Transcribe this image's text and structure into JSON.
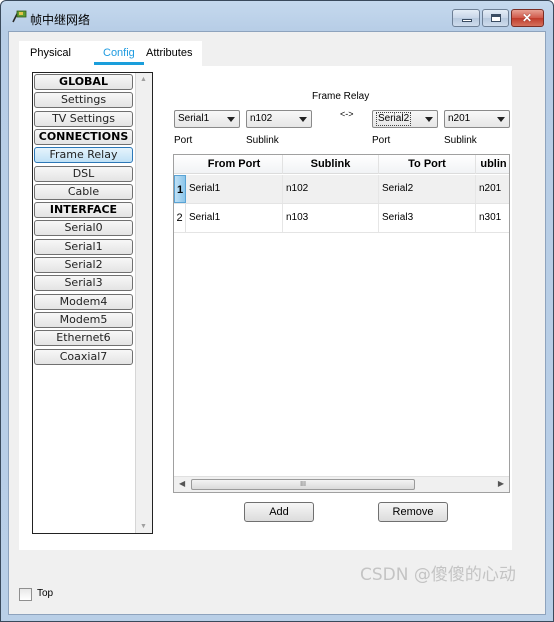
{
  "window": {
    "title": "帧中继网络",
    "controls": {
      "minimize": "minimize",
      "maximize": "maximize",
      "close": "✕"
    }
  },
  "tabs": [
    {
      "label": "Physical",
      "active": false
    },
    {
      "label": "Config",
      "active": true
    },
    {
      "label": "Attributes",
      "active": false
    }
  ],
  "sidebar": {
    "items": [
      {
        "label": "GLOBAL",
        "type": "header"
      },
      {
        "label": "Settings",
        "type": "item"
      },
      {
        "label": "TV Settings",
        "type": "item"
      },
      {
        "label": "CONNECTIONS",
        "type": "header"
      },
      {
        "label": "Frame Relay",
        "type": "item",
        "active": true
      },
      {
        "label": "DSL",
        "type": "item"
      },
      {
        "label": "Cable",
        "type": "item"
      },
      {
        "label": "INTERFACE",
        "type": "header"
      },
      {
        "label": "Serial0",
        "type": "item"
      },
      {
        "label": "Serial1",
        "type": "item"
      },
      {
        "label": "Serial2",
        "type": "item"
      },
      {
        "label": "Serial3",
        "type": "item"
      },
      {
        "label": "Modem4",
        "type": "item"
      },
      {
        "label": "Modem5",
        "type": "item"
      },
      {
        "label": "Ethernet6",
        "type": "item"
      },
      {
        "label": "Coaxial7",
        "type": "item"
      }
    ]
  },
  "frame_relay": {
    "title": "Frame Relay",
    "arrow": "<->",
    "from_port": {
      "value": "Serial1",
      "label": "Port"
    },
    "from_sublink": {
      "value": "n102",
      "label": "Sublink"
    },
    "to_port": {
      "value": "Serial2",
      "label": "Port"
    },
    "to_sublink": {
      "value": "n201",
      "label": "Sublink"
    }
  },
  "table": {
    "columns": [
      "From Port",
      "Sublink",
      "To Port",
      "ublin"
    ],
    "rows": [
      {
        "num": "1",
        "from_port": "Serial1",
        "sublink": "n102",
        "to_port": "Serial2",
        "to_sublink": "n201",
        "selected": true
      },
      {
        "num": "2",
        "from_port": "Serial1",
        "sublink": "n103",
        "to_port": "Serial3",
        "to_sublink": "n301",
        "selected": false
      }
    ],
    "scroll_thumb": "III"
  },
  "buttons": {
    "add": "Add",
    "remove": "Remove"
  },
  "footer": {
    "top_label": "Top",
    "top_checked": false
  },
  "watermark": "CSDN @傻傻的心动"
}
